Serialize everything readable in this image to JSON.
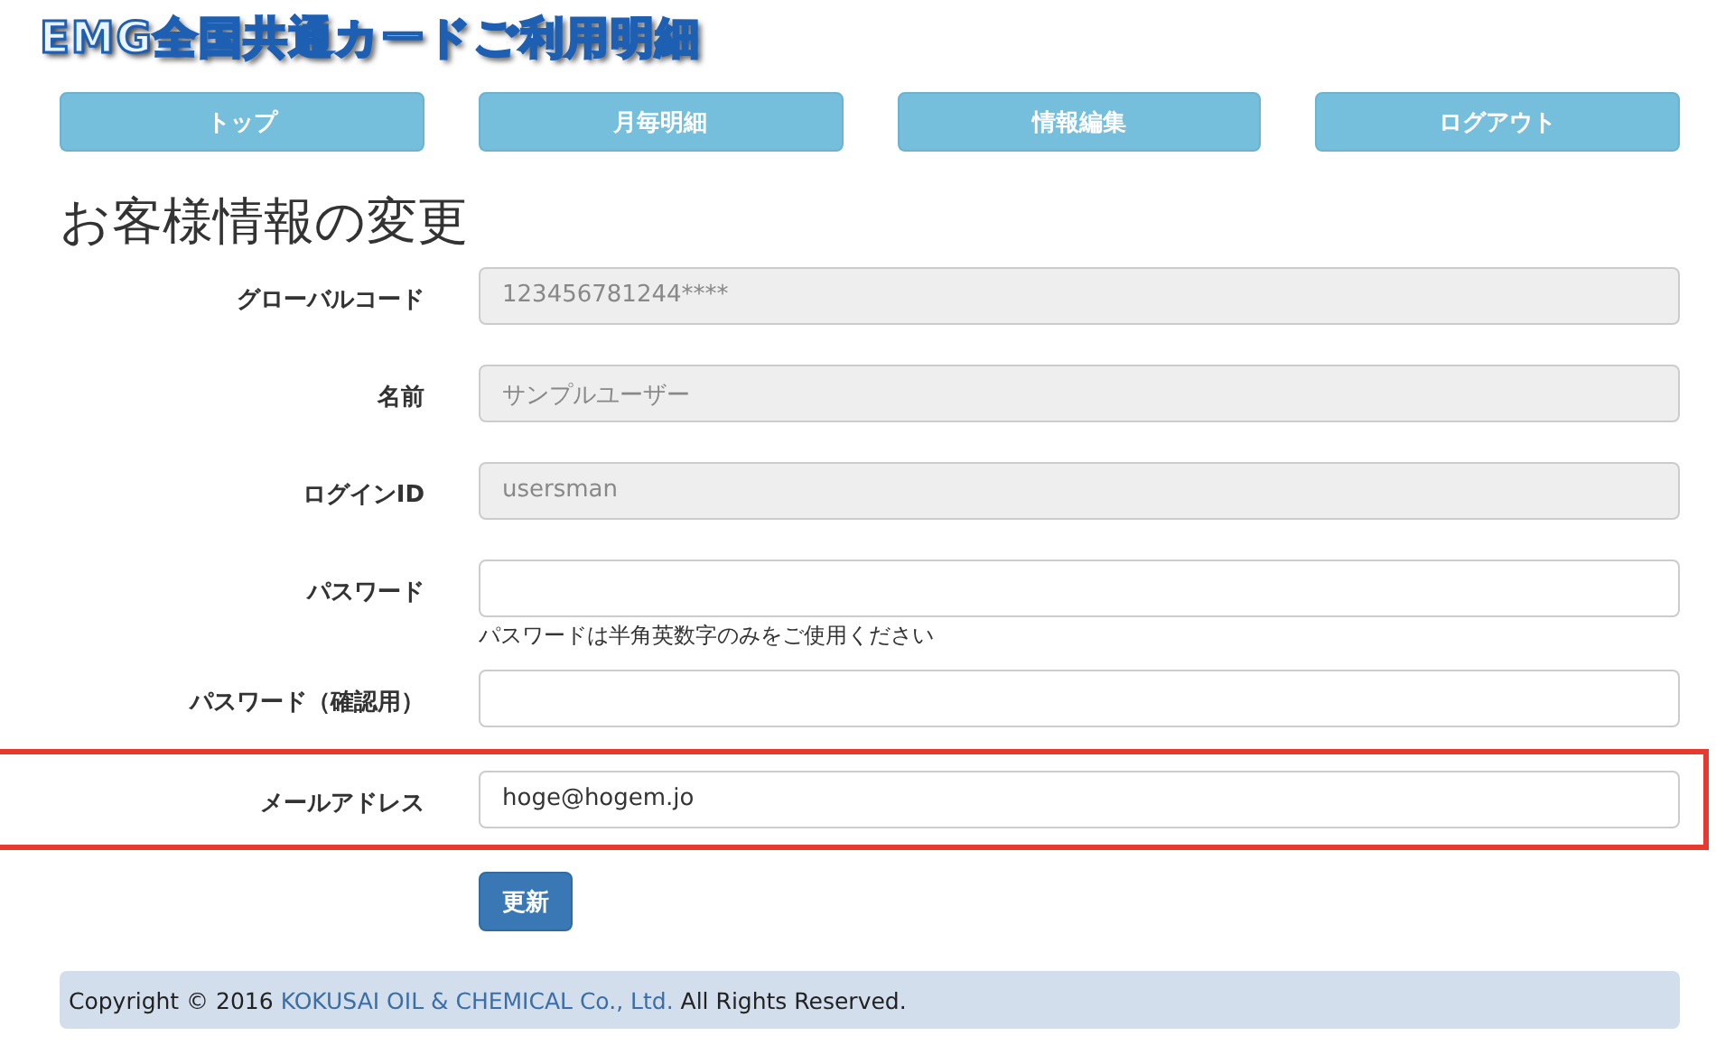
{
  "logo": "EMG全国共通カードご利用明細",
  "nav": [
    {
      "label": "トップ"
    },
    {
      "label": "月毎明細"
    },
    {
      "label": "情報編集"
    },
    {
      "label": "ログアウト"
    }
  ],
  "heading": "お客様情報の変更",
  "fields": [
    {
      "label": "グローバルコード",
      "kind": "readonly",
      "value": "123456781244****",
      "highlighted": false
    },
    {
      "label": "名前",
      "kind": "readonly",
      "value": "サンプルユーザー",
      "highlighted": false
    },
    {
      "label": "ログインID",
      "kind": "readonly",
      "value": "usersman",
      "highlighted": false
    },
    {
      "label": "パスワード",
      "kind": "input",
      "help": "パスワードは半角英数字のみをご使用ください",
      "highlighted": false
    },
    {
      "label": "パスワード（確認用）",
      "kind": "input",
      "highlighted": false
    },
    {
      "label": "メールアドレス",
      "kind": "input",
      "value": "hoge@hogem.jo",
      "highlighted": true
    }
  ],
  "submit": "更新",
  "footer": {
    "before": "Copyright © 2016 ",
    "link": "KOKUSAI OIL & CHEMICAL Co., Ltd.",
    "after": " All Rights Reserved."
  }
}
